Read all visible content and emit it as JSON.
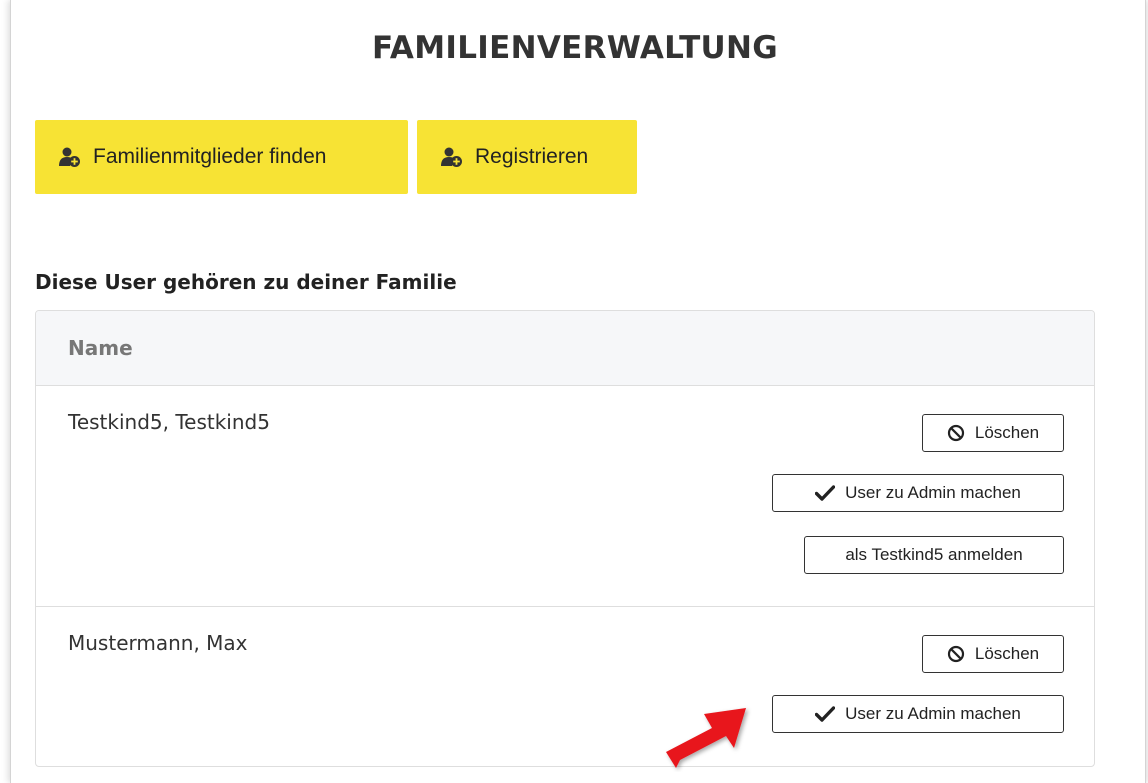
{
  "page": {
    "title": "FAMILIENVERWALTUNG"
  },
  "actions": {
    "find_label": "Familienmitglieder finden",
    "register_label": "Registrieren"
  },
  "family": {
    "heading": "Diese User gehören zu deiner Familie",
    "column_name": "Name",
    "members": [
      {
        "name": "Testkind5, Testkind5",
        "delete_label": "Löschen",
        "make_admin_label": "User zu Admin machen",
        "login_as_label": "als Testkind5 anmelden"
      },
      {
        "name": "Mustermann, Max",
        "delete_label": "Löschen",
        "make_admin_label": "User zu Admin machen"
      }
    ]
  },
  "colors": {
    "accent_yellow": "#f7e334",
    "annotation_arrow": "#e8141b"
  }
}
